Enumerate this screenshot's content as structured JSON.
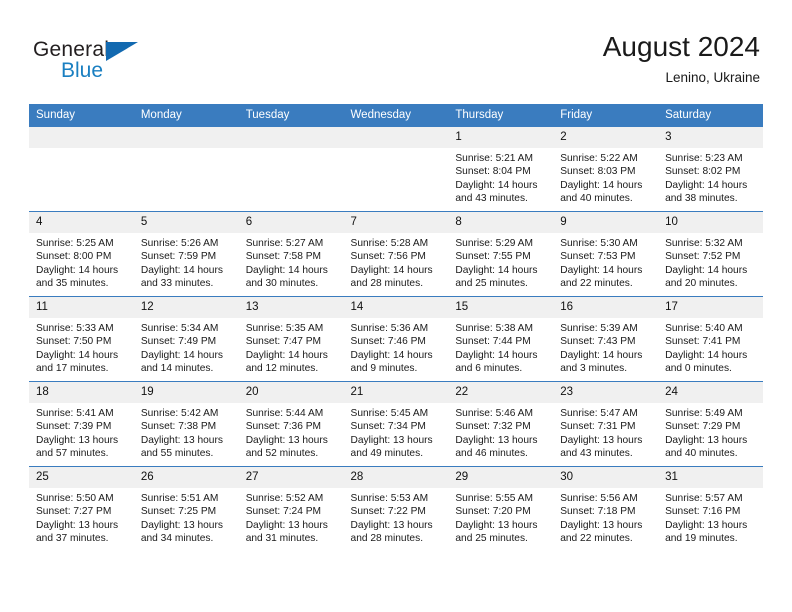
{
  "brand": {
    "name_part1": "General",
    "name_part2": "Blue",
    "triangle_icon": "brand-triangle-icon",
    "colors": {
      "general_text": "#231f20",
      "blue_text": "#1a7fc1",
      "triangle": "#1269b0"
    }
  },
  "header": {
    "title": "August 2024",
    "subtitle": "Lenino, Ukraine"
  },
  "theme": {
    "header_row_bg": "#3a7cbf",
    "header_row_text": "#ffffff",
    "daynum_bg": "#f0f0f0",
    "cell_bg": "#ffffff",
    "cell_border": "#3a7cbf"
  },
  "weekdays": [
    "Sunday",
    "Monday",
    "Tuesday",
    "Wednesday",
    "Thursday",
    "Friday",
    "Saturday"
  ],
  "labels": {
    "sunrise": "Sunrise:",
    "sunset": "Sunset:",
    "daylight": "Daylight:"
  },
  "weeks": [
    [
      {
        "blank": true
      },
      {
        "blank": true
      },
      {
        "blank": true
      },
      {
        "blank": true
      },
      {
        "day": "1",
        "line1": "Sunrise: 5:21 AM",
        "line2": "Sunset: 8:04 PM",
        "line3": "Daylight: 14 hours",
        "line4": "and 43 minutes."
      },
      {
        "day": "2",
        "line1": "Sunrise: 5:22 AM",
        "line2": "Sunset: 8:03 PM",
        "line3": "Daylight: 14 hours",
        "line4": "and 40 minutes."
      },
      {
        "day": "3",
        "line1": "Sunrise: 5:23 AM",
        "line2": "Sunset: 8:02 PM",
        "line3": "Daylight: 14 hours",
        "line4": "and 38 minutes."
      }
    ],
    [
      {
        "day": "4",
        "line1": "Sunrise: 5:25 AM",
        "line2": "Sunset: 8:00 PM",
        "line3": "Daylight: 14 hours",
        "line4": "and 35 minutes."
      },
      {
        "day": "5",
        "line1": "Sunrise: 5:26 AM",
        "line2": "Sunset: 7:59 PM",
        "line3": "Daylight: 14 hours",
        "line4": "and 33 minutes."
      },
      {
        "day": "6",
        "line1": "Sunrise: 5:27 AM",
        "line2": "Sunset: 7:58 PM",
        "line3": "Daylight: 14 hours",
        "line4": "and 30 minutes."
      },
      {
        "day": "7",
        "line1": "Sunrise: 5:28 AM",
        "line2": "Sunset: 7:56 PM",
        "line3": "Daylight: 14 hours",
        "line4": "and 28 minutes."
      },
      {
        "day": "8",
        "line1": "Sunrise: 5:29 AM",
        "line2": "Sunset: 7:55 PM",
        "line3": "Daylight: 14 hours",
        "line4": "and 25 minutes."
      },
      {
        "day": "9",
        "line1": "Sunrise: 5:30 AM",
        "line2": "Sunset: 7:53 PM",
        "line3": "Daylight: 14 hours",
        "line4": "and 22 minutes."
      },
      {
        "day": "10",
        "line1": "Sunrise: 5:32 AM",
        "line2": "Sunset: 7:52 PM",
        "line3": "Daylight: 14 hours",
        "line4": "and 20 minutes."
      }
    ],
    [
      {
        "day": "11",
        "line1": "Sunrise: 5:33 AM",
        "line2": "Sunset: 7:50 PM",
        "line3": "Daylight: 14 hours",
        "line4": "and 17 minutes."
      },
      {
        "day": "12",
        "line1": "Sunrise: 5:34 AM",
        "line2": "Sunset: 7:49 PM",
        "line3": "Daylight: 14 hours",
        "line4": "and 14 minutes."
      },
      {
        "day": "13",
        "line1": "Sunrise: 5:35 AM",
        "line2": "Sunset: 7:47 PM",
        "line3": "Daylight: 14 hours",
        "line4": "and 12 minutes."
      },
      {
        "day": "14",
        "line1": "Sunrise: 5:36 AM",
        "line2": "Sunset: 7:46 PM",
        "line3": "Daylight: 14 hours",
        "line4": "and 9 minutes."
      },
      {
        "day": "15",
        "line1": "Sunrise: 5:38 AM",
        "line2": "Sunset: 7:44 PM",
        "line3": "Daylight: 14 hours",
        "line4": "and 6 minutes."
      },
      {
        "day": "16",
        "line1": "Sunrise: 5:39 AM",
        "line2": "Sunset: 7:43 PM",
        "line3": "Daylight: 14 hours",
        "line4": "and 3 minutes."
      },
      {
        "day": "17",
        "line1": "Sunrise: 5:40 AM",
        "line2": "Sunset: 7:41 PM",
        "line3": "Daylight: 14 hours",
        "line4": "and 0 minutes."
      }
    ],
    [
      {
        "day": "18",
        "line1": "Sunrise: 5:41 AM",
        "line2": "Sunset: 7:39 PM",
        "line3": "Daylight: 13 hours",
        "line4": "and 57 minutes."
      },
      {
        "day": "19",
        "line1": "Sunrise: 5:42 AM",
        "line2": "Sunset: 7:38 PM",
        "line3": "Daylight: 13 hours",
        "line4": "and 55 minutes."
      },
      {
        "day": "20",
        "line1": "Sunrise: 5:44 AM",
        "line2": "Sunset: 7:36 PM",
        "line3": "Daylight: 13 hours",
        "line4": "and 52 minutes."
      },
      {
        "day": "21",
        "line1": "Sunrise: 5:45 AM",
        "line2": "Sunset: 7:34 PM",
        "line3": "Daylight: 13 hours",
        "line4": "and 49 minutes."
      },
      {
        "day": "22",
        "line1": "Sunrise: 5:46 AM",
        "line2": "Sunset: 7:32 PM",
        "line3": "Daylight: 13 hours",
        "line4": "and 46 minutes."
      },
      {
        "day": "23",
        "line1": "Sunrise: 5:47 AM",
        "line2": "Sunset: 7:31 PM",
        "line3": "Daylight: 13 hours",
        "line4": "and 43 minutes."
      },
      {
        "day": "24",
        "line1": "Sunrise: 5:49 AM",
        "line2": "Sunset: 7:29 PM",
        "line3": "Daylight: 13 hours",
        "line4": "and 40 minutes."
      }
    ],
    [
      {
        "day": "25",
        "line1": "Sunrise: 5:50 AM",
        "line2": "Sunset: 7:27 PM",
        "line3": "Daylight: 13 hours",
        "line4": "and 37 minutes."
      },
      {
        "day": "26",
        "line1": "Sunrise: 5:51 AM",
        "line2": "Sunset: 7:25 PM",
        "line3": "Daylight: 13 hours",
        "line4": "and 34 minutes."
      },
      {
        "day": "27",
        "line1": "Sunrise: 5:52 AM",
        "line2": "Sunset: 7:24 PM",
        "line3": "Daylight: 13 hours",
        "line4": "and 31 minutes."
      },
      {
        "day": "28",
        "line1": "Sunrise: 5:53 AM",
        "line2": "Sunset: 7:22 PM",
        "line3": "Daylight: 13 hours",
        "line4": "and 28 minutes."
      },
      {
        "day": "29",
        "line1": "Sunrise: 5:55 AM",
        "line2": "Sunset: 7:20 PM",
        "line3": "Daylight: 13 hours",
        "line4": "and 25 minutes."
      },
      {
        "day": "30",
        "line1": "Sunrise: 5:56 AM",
        "line2": "Sunset: 7:18 PM",
        "line3": "Daylight: 13 hours",
        "line4": "and 22 minutes."
      },
      {
        "day": "31",
        "line1": "Sunrise: 5:57 AM",
        "line2": "Sunset: 7:16 PM",
        "line3": "Daylight: 13 hours",
        "line4": "and 19 minutes."
      }
    ]
  ]
}
